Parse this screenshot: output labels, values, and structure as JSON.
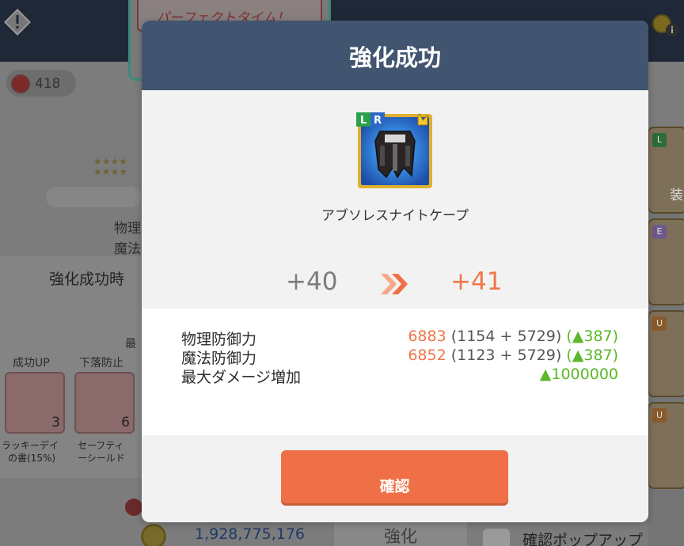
{
  "background": {
    "banner_text": "パーフェクトタイム！",
    "currency_value": "418",
    "stat_labels": [
      "物理",
      "魔法"
    ],
    "success_title": "強化成功時",
    "max_label": "最",
    "item_slots": [
      {
        "header": "成功UP",
        "count": "3",
        "name_line1": "ラッキーデイ",
        "name_line2": "の書(15%)"
      },
      {
        "header": "下落防止",
        "count": "6",
        "name_line1": "セーフティ",
        "name_line2": "ーシールド"
      }
    ],
    "gold_value": "1,928,775,176",
    "enhance_button": "強化",
    "popup_checkbox_label": "確認ポップアップ",
    "right_badges": [
      "L",
      "E",
      "U",
      "U"
    ],
    "right_equip_label": "装"
  },
  "dialog": {
    "title": "強化成功",
    "item_name": "アブソレスナイトケープ",
    "level_before": "+40",
    "level_after": "+41",
    "item_badges": [
      "L",
      "R"
    ],
    "stats": [
      {
        "name": "物理防御力",
        "value": "6883",
        "calc": "(1154 + 5729)",
        "increase": "(▲387)"
      },
      {
        "name": "魔法防御力",
        "value": "6852",
        "calc": "(1123 + 5729)",
        "increase": "(▲387)"
      },
      {
        "name": "最大ダメージ増加",
        "value": "",
        "calc": "",
        "increase": "▲1000000"
      }
    ],
    "confirm_button": "確認"
  },
  "colors": {
    "header": "#415470",
    "accent_orange": "#ef7047",
    "increase_green": "#5cb82a"
  }
}
